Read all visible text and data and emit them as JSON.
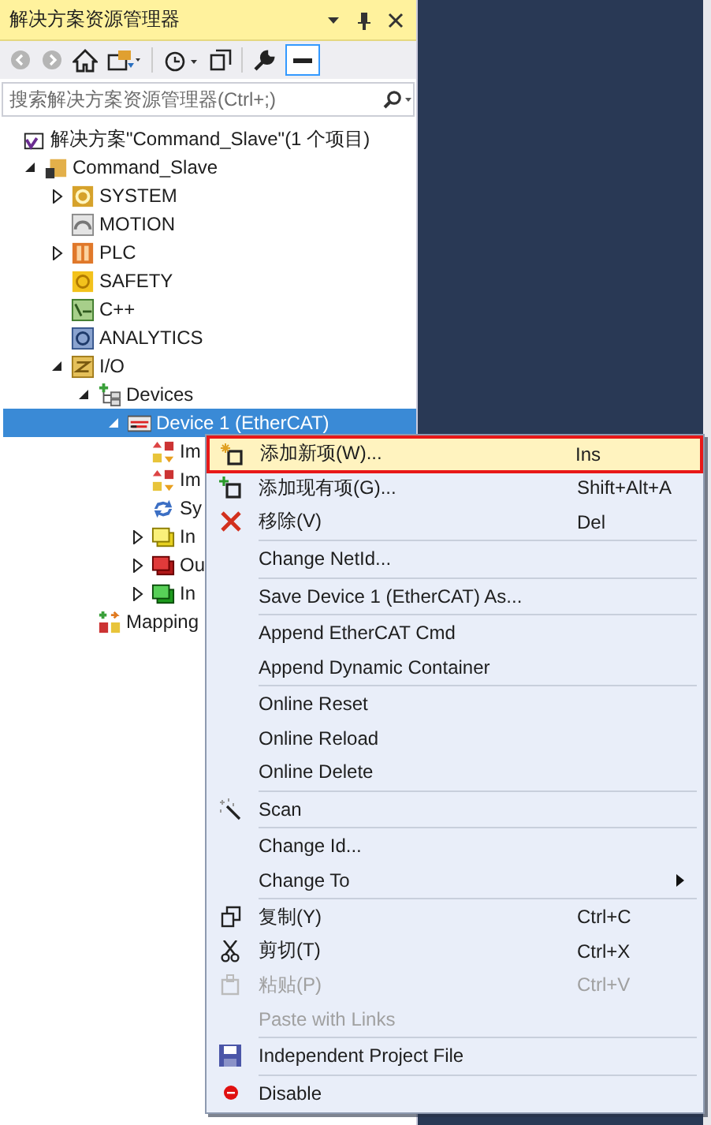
{
  "panel": {
    "title": "解决方案资源管理器"
  },
  "search": {
    "placeholder": "搜索解决方案资源管理器(Ctrl+;)"
  },
  "tree": [
    {
      "label": "解决方案\"Command_Slave\"(1 个项目)",
      "selected": false,
      "children": [
        {
          "label": "Command_Slave",
          "selected": false,
          "expanded": true,
          "children": [
            {
              "label": "SYSTEM",
              "selected": false,
              "expanded": false
            },
            {
              "label": "MOTION",
              "selected": false
            },
            {
              "label": "PLC",
              "selected": false,
              "expanded": false
            },
            {
              "label": "SAFETY",
              "selected": false
            },
            {
              "label": "C++",
              "selected": false
            },
            {
              "label": "ANALYTICS",
              "selected": false
            },
            {
              "label": "I/O",
              "selected": false,
              "expanded": true,
              "children": [
                {
                  "label": "Devices",
                  "selected": false,
                  "expanded": true,
                  "children": [
                    {
                      "label": "Device 1 (EtherCAT)",
                      "selected": true,
                      "expanded": true,
                      "children": [
                        {
                          "label": "Im",
                          "selected": false
                        },
                        {
                          "label": "Im",
                          "selected": false
                        },
                        {
                          "label": "Sy",
                          "selected": false
                        },
                        {
                          "label": "In",
                          "selected": false,
                          "expanded": false
                        },
                        {
                          "label": "Ou",
                          "selected": false,
                          "expanded": false
                        },
                        {
                          "label": "In",
                          "selected": false,
                          "expanded": false
                        }
                      ]
                    }
                  ]
                },
                {
                  "label": "Mapping",
                  "selected": false
                }
              ]
            }
          ]
        }
      ]
    }
  ],
  "context_menu": {
    "groups": [
      [
        {
          "label": "添加新项(W)...",
          "shortcut": "Ins",
          "selected": true,
          "disabled": false
        },
        {
          "label": "添加现有项(G)...",
          "shortcut": "Shift+Alt+A",
          "selected": false,
          "disabled": false
        },
        {
          "label": "移除(V)",
          "shortcut": "Del",
          "selected": false,
          "disabled": false
        }
      ],
      [
        {
          "label": "Change NetId...",
          "selected": false,
          "disabled": false
        }
      ],
      [
        {
          "label": "Save Device 1 (EtherCAT) As...",
          "selected": false,
          "disabled": false
        }
      ],
      [
        {
          "label": "Append EtherCAT Cmd",
          "selected": false,
          "disabled": false
        },
        {
          "label": "Append Dynamic Container",
          "selected": false,
          "disabled": false
        }
      ],
      [
        {
          "label": "Online Reset",
          "selected": false,
          "disabled": false
        },
        {
          "label": "Online Reload",
          "selected": false,
          "disabled": false
        },
        {
          "label": "Online Delete",
          "selected": false,
          "disabled": false
        }
      ],
      [
        {
          "label": "Scan",
          "selected": false,
          "disabled": false
        }
      ],
      [
        {
          "label": "Change Id...",
          "selected": false,
          "disabled": false
        },
        {
          "label": "Change To",
          "selected": false,
          "disabled": false,
          "submenu": true
        }
      ],
      [
        {
          "label": "复制(Y)",
          "shortcut": "Ctrl+C",
          "selected": false,
          "disabled": false
        },
        {
          "label": "剪切(T)",
          "shortcut": "Ctrl+X",
          "selected": false,
          "disabled": false
        },
        {
          "label": "粘贴(P)",
          "shortcut": "Ctrl+V",
          "selected": false,
          "disabled": true
        },
        {
          "label": "Paste with Links",
          "selected": false,
          "disabled": true
        }
      ],
      [
        {
          "label": "Independent Project File",
          "selected": false,
          "disabled": false
        }
      ],
      [
        {
          "label": "Disable",
          "selected": false,
          "disabled": false
        }
      ]
    ]
  }
}
